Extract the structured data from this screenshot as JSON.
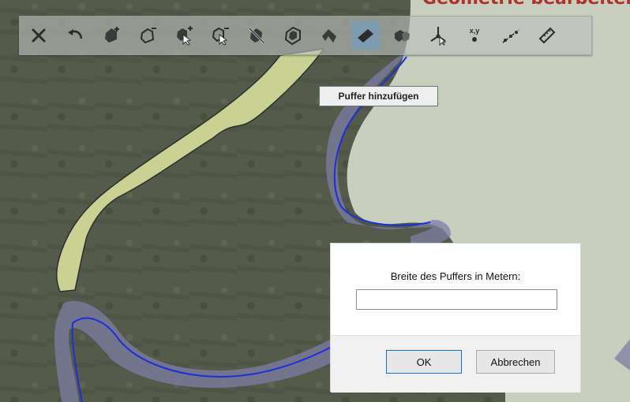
{
  "header": {
    "title": "Geometrie bearbeiten"
  },
  "toolbar": {
    "buttons": [
      {
        "icon": "close-icon"
      },
      {
        "icon": "undo-icon"
      },
      {
        "icon": "polygon-add-icon"
      },
      {
        "icon": "polygon-subtract-icon"
      },
      {
        "icon": "select-add-icon"
      },
      {
        "icon": "select-subtract-icon"
      },
      {
        "icon": "delete-feature-icon"
      },
      {
        "icon": "buffer-icon"
      },
      {
        "icon": "parallel-icon"
      },
      {
        "icon": "ruler-icon",
        "active": true
      },
      {
        "icon": "merge-icon"
      },
      {
        "icon": "vertex-move-icon"
      },
      {
        "icon": "xy-point-icon",
        "label": "x,y"
      },
      {
        "icon": "line-split-icon"
      },
      {
        "icon": "measure-icon"
      }
    ]
  },
  "tooltip": {
    "text": "Puffer hinzufügen"
  },
  "dialog": {
    "label": "Breite des Puffers in Metern:",
    "input_value": "",
    "input_placeholder": "",
    "ok_label": "OK",
    "cancel_label": "Abbrechen"
  },
  "colors": {
    "map_background": "#545a48",
    "water": "#c8cfbf",
    "selected_fill": "#d6df9a",
    "buffer_fill": "#7d7ea6",
    "boundary_line": "#1c2fd9",
    "active_button": "#6ea0c8",
    "title": "#b0302c"
  }
}
